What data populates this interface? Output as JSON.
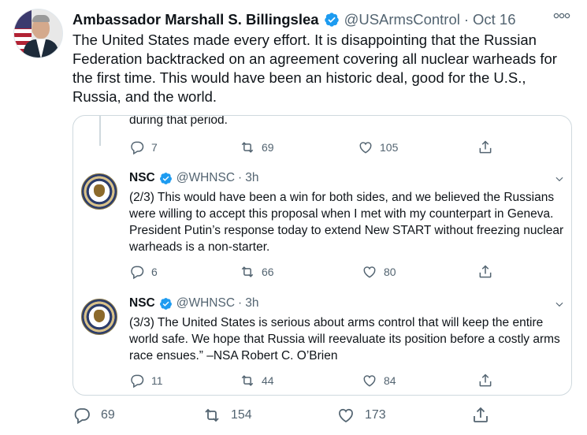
{
  "tweet": {
    "author_name": "Ambassador Marshall S. Billingslea",
    "handle": "@USArmsControl",
    "separator": "·",
    "date": "Oct 16",
    "text": "The United States made every effort. It is disappointing that the Russian Federation backtracked on an agreement covering all nuclear warheads for the first time. This would have been an historic deal, good for the U.S., Russia, and the world.",
    "stats": {
      "replies": "69",
      "retweets": "154",
      "likes": "173"
    }
  },
  "quoted": {
    "partial": {
      "text": "during that period.",
      "stats": {
        "replies": "7",
        "retweets": "69",
        "likes": "105"
      }
    },
    "tweets": [
      {
        "name": "NSC",
        "handle": "@WHNSC",
        "separator": "·",
        "time": "3h",
        "text": "(2/3) This would have been a win for both sides, and we believed the Russians were willing to accept this proposal when I met with my counterpart in Geneva.  President Putin’s response today to extend New START without freezing nuclear warheads is a non-starter.",
        "stats": {
          "replies": "6",
          "retweets": "66",
          "likes": "80"
        }
      },
      {
        "name": "NSC",
        "handle": "@WHNSC",
        "separator": "·",
        "time": "3h",
        "text": "(3/3) The United States is serious about arms control that will keep the entire world safe.  We hope that Russia will reevaluate its position before a costly arms race ensues.” –NSA Robert C. O’Brien",
        "stats": {
          "replies": "11",
          "retweets": "44",
          "likes": "84"
        }
      }
    ]
  },
  "colors": {
    "accent": "#1d9bf0",
    "muted": "#536471",
    "border": "#cfd9de",
    "text": "#0f1419"
  }
}
